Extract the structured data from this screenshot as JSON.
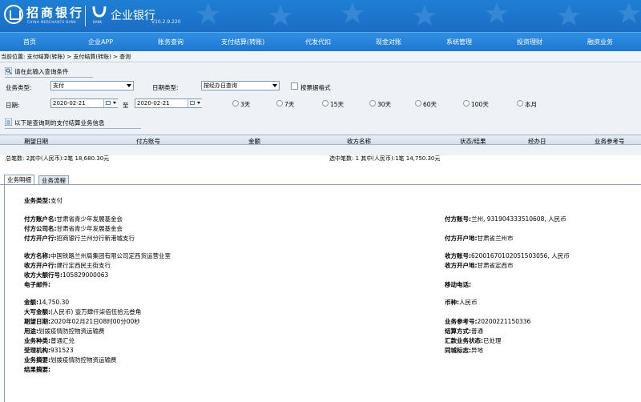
{
  "header": {
    "brand_cn": "招商银行",
    "brand_en": "CHINA MERCHANTS BANK",
    "bank_sub": "BANK",
    "system_title": "企业银行",
    "version": "V10.2.9.220"
  },
  "nav": [
    "首页",
    "企业APP",
    "账务查询",
    "支付结算(转账)",
    "代发代扣",
    "现金对账",
    "系统管理",
    "投资理财",
    "融资业务"
  ],
  "breadcrumb": "当前位置: 支付结算(转账) > 支付结算(转账) > 查询",
  "query": {
    "section_title": "请在此输入查询条件",
    "biz_type_label": "业务类型:",
    "biz_type_value": "支付",
    "date_type_label": "日期类型:",
    "date_type_value": "按经办日查询",
    "receipt_format_label": "按票据格式",
    "date_label": "日期:",
    "date_from": "2020-02-21",
    "to_label": "至",
    "date_to": "2020-02-21",
    "ranges": [
      "3天",
      "7天",
      "15天",
      "30天",
      "60天",
      "100天",
      "本月"
    ]
  },
  "results": {
    "section_title": "以下是查询到的支付结算业务信息",
    "columns": [
      "期望日期",
      "付方账号",
      "金额",
      "收方名称",
      "状态/结果",
      "经办日",
      "业务参考号"
    ],
    "total_summary": "总笔数: 2其中(人民币):2笔  18,680.30元",
    "selected_summary": "选中笔数: 1 其中(人民币):1笔  14,750.30元"
  },
  "tabs": [
    "业务明细",
    "业务流程"
  ],
  "detail": {
    "biz_type": {
      "label": "业务类型:",
      "value": "支付"
    },
    "payer_name": {
      "label": "付方账户名:",
      "value": "甘肃省青少年发展基金会"
    },
    "payer_company": {
      "label": "付方公司名:",
      "value": "甘肃省青少年发展基金会"
    },
    "payer_bank": {
      "label": "付方开户行:",
      "value": "招商银行兰州分行新港城支行"
    },
    "payer_account": {
      "label": "付方账号:",
      "value": "兰州, 931904333510608, 人民币"
    },
    "payer_location": {
      "label": "付方开户地:",
      "value": "甘肃省兰州市"
    },
    "payee_name": {
      "label": "收方名称:",
      "value": "中国铁路兰州局集团有限公司定西货运营业室"
    },
    "payee_bank": {
      "label": "收方开户行:",
      "value": "建行定西民主街支行"
    },
    "payee_bank_no": {
      "label": "收方大额行号:",
      "value": "105829000063"
    },
    "email": {
      "label": "电子邮件:",
      "value": ""
    },
    "payee_account": {
      "label": "收方账号:",
      "value": "62001670102051503056, 人民币"
    },
    "payee_location": {
      "label": "收方开户地:",
      "value": "甘肃省定西市"
    },
    "mobile": {
      "label": "移动电话:",
      "value": ""
    },
    "amount": {
      "label": "金额:",
      "value": "14,750.30"
    },
    "amount_upper": {
      "label": "大写金额:",
      "value": "(人民币) 壹万肆仟柒佰伍拾元叁角"
    },
    "expect_date": {
      "label": "期望日期:",
      "value": "2020年02月21日08时00分00秒"
    },
    "purpose": {
      "label": "用途:",
      "value": "划拨疫情防控物资运输费"
    },
    "biz_kind": {
      "label": "业务种类:",
      "value": "普通汇兑"
    },
    "org": {
      "label": "受理机构:",
      "value": "931523"
    },
    "biz_summary": {
      "label": "业务摘要:",
      "value": "划拨疫情防控物资运输费"
    },
    "result_summary": {
      "label": "结果摘要:",
      "value": ""
    },
    "currency": {
      "label": "币种:",
      "value": "人民币"
    },
    "ref_no": {
      "label": "业务参考号:",
      "value": "20200221150336"
    },
    "settle_mode": {
      "label": "结算方式:",
      "value": "普通"
    },
    "remit_status": {
      "label": "汇款业务状态:",
      "value": "已处理"
    },
    "intercity": {
      "label": "同城标志:",
      "value": "异地"
    }
  },
  "colors": {
    "header_bg": "#1a6ec4",
    "nav_bg": "#2f8fe3",
    "query_bg": "#eef2f7",
    "border": "#8aa0bb"
  }
}
